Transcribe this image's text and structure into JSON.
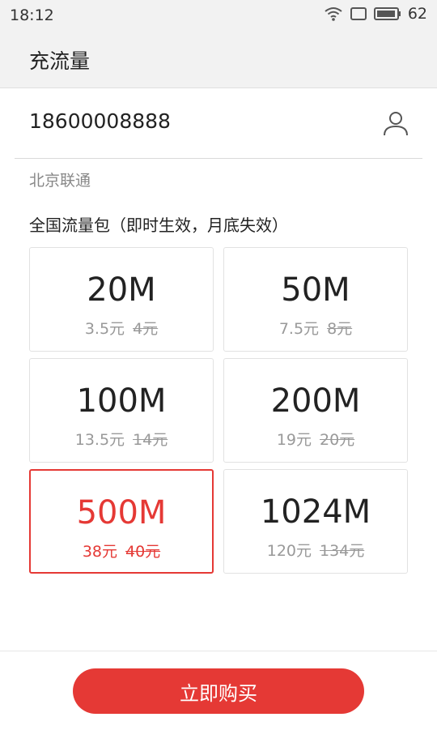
{
  "status_bar": {
    "time": "18:12",
    "battery_level": "62",
    "icons": [
      "wifi-icon",
      "screen-rotate-icon",
      "battery-icon"
    ]
  },
  "app_bar": {
    "title": "充流量"
  },
  "phone": {
    "value": "18600008888",
    "contact_icon": "person-icon"
  },
  "carrier": "北京联通",
  "section_title": "全国流量包（即时生效，月底失效）",
  "packages": [
    {
      "size": "20M",
      "price": "3.5元",
      "original": "4元",
      "selected": false
    },
    {
      "size": "50M",
      "price": "7.5元",
      "original": "8元",
      "selected": false
    },
    {
      "size": "100M",
      "price": "13.5元",
      "original": "14元",
      "selected": false
    },
    {
      "size": "200M",
      "price": "19元",
      "original": "20元",
      "selected": false
    },
    {
      "size": "500M",
      "price": "38元",
      "original": "40元",
      "selected": true
    },
    {
      "size": "1024M",
      "price": "120元",
      "original": "134元",
      "selected": false
    }
  ],
  "buy_button": {
    "label": "立即购买"
  },
  "colors": {
    "accent": "#e53935",
    "header_bg": "#f2f2f2"
  }
}
